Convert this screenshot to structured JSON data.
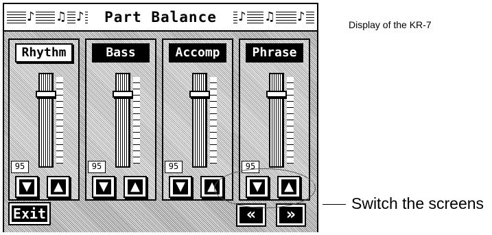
{
  "screen": {
    "title": "Part Balance",
    "parts": [
      {
        "label": "Rhythm",
        "value": "95",
        "level": 95,
        "active": true
      },
      {
        "label": "Bass",
        "value": "95",
        "level": 95,
        "active": false
      },
      {
        "label": "Accomp",
        "value": "95",
        "level": 95,
        "active": false
      },
      {
        "label": "Phrase",
        "value": "95",
        "level": 95,
        "active": false
      }
    ],
    "down_icon": "down-arrow-icon",
    "up_icon": "up-arrow-icon",
    "exit_label": "Exit",
    "prev_label": "«",
    "next_label": "»"
  },
  "annotations": {
    "caption": "Display of the KR-7",
    "switch_label": "Switch the screens"
  }
}
